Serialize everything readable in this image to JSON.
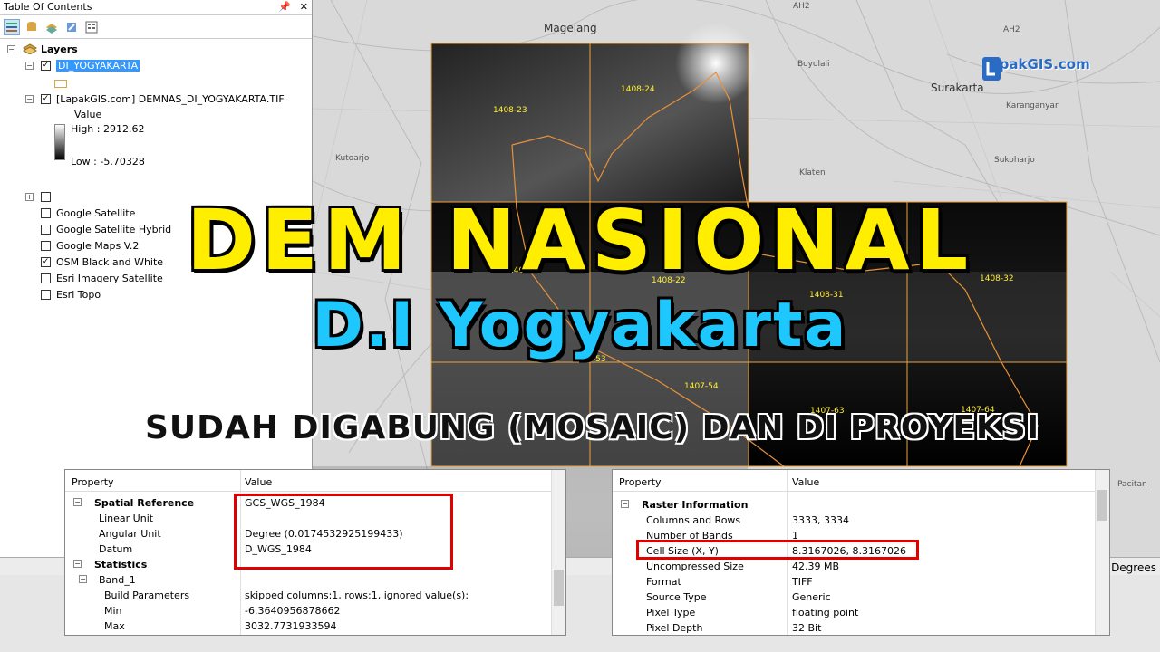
{
  "toc": {
    "title": "Table Of Contents",
    "layers_label": "Layers",
    "layer1": "DI_YOGYAKARTA",
    "layer2": "[LapakGIS.com] DEMNAS_DI_YOGYAKARTA.TIF",
    "value_label": "Value",
    "high_label": "High : 2912.62",
    "low_label": "Low : -5.70328",
    "basemaps": [
      {
        "label": "Google Satellite",
        "checked": false
      },
      {
        "label": "Google Satellite Hybrid",
        "checked": false
      },
      {
        "label": "Google Maps V.2",
        "checked": false
      },
      {
        "label": "OSM Black and White",
        "checked": true
      },
      {
        "label": "Esri Imagery Satellite",
        "checked": false
      },
      {
        "label": "Esri Topo",
        "checked": false
      }
    ]
  },
  "map": {
    "places": [
      "Magelang",
      "Boyolali",
      "Surakarta",
      "Karanganyar",
      "Klaten",
      "Sukoharjo",
      "Kutoarjo",
      "Pacitan",
      "AH2"
    ],
    "tiles": [
      "1408-23",
      "1408-24",
      "1408-21",
      "1408-22",
      "1408-31",
      "1408-32",
      "1407-53",
      "1407-54",
      "1407-63",
      "1407-64"
    ],
    "logo": "LapakGIS.com"
  },
  "overlay": {
    "line1": "DEM NASIONAL",
    "line2": "D.I Yogyakarta",
    "line3": "SUDAH DIGABUNG (MOSAIC) DAN DI PROYEKSI"
  },
  "left_panel": {
    "col1": "Property",
    "col2": "Value",
    "rows": [
      {
        "k": "Spatial Reference",
        "v": "GCS_WGS_1984"
      },
      {
        "k": "Linear Unit",
        "v": ""
      },
      {
        "k": "Angular Unit",
        "v": "Degree (0.0174532925199433)"
      },
      {
        "k": "Datum",
        "v": "D_WGS_1984"
      },
      {
        "k": "Statistics",
        "v": ""
      },
      {
        "k": "Band_1",
        "v": ""
      },
      {
        "k": "Build Parameters",
        "v": "skipped columns:1, rows:1, ignored value(s):"
      },
      {
        "k": "Min",
        "v": "-6.3640956878662"
      },
      {
        "k": "Max",
        "v": "3032.7731933594"
      }
    ]
  },
  "right_panel": {
    "col1": "Property",
    "col2": "Value",
    "rows": [
      {
        "k": "Raster Information",
        "v": ""
      },
      {
        "k": "Columns and Rows",
        "v": "3333, 3334"
      },
      {
        "k": "Number of Bands",
        "v": "1"
      },
      {
        "k": "Cell Size (X, Y)",
        "v": "8.3167026, 8.3167026"
      },
      {
        "k": "Uncompressed Size",
        "v": "42.39 MB"
      },
      {
        "k": "Format",
        "v": "TIFF"
      },
      {
        "k": "Source Type",
        "v": "Generic"
      },
      {
        "k": "Pixel Type",
        "v": "floating point"
      },
      {
        "k": "Pixel Depth",
        "v": "32 Bit"
      }
    ]
  },
  "status": {
    "units": "Degrees"
  }
}
